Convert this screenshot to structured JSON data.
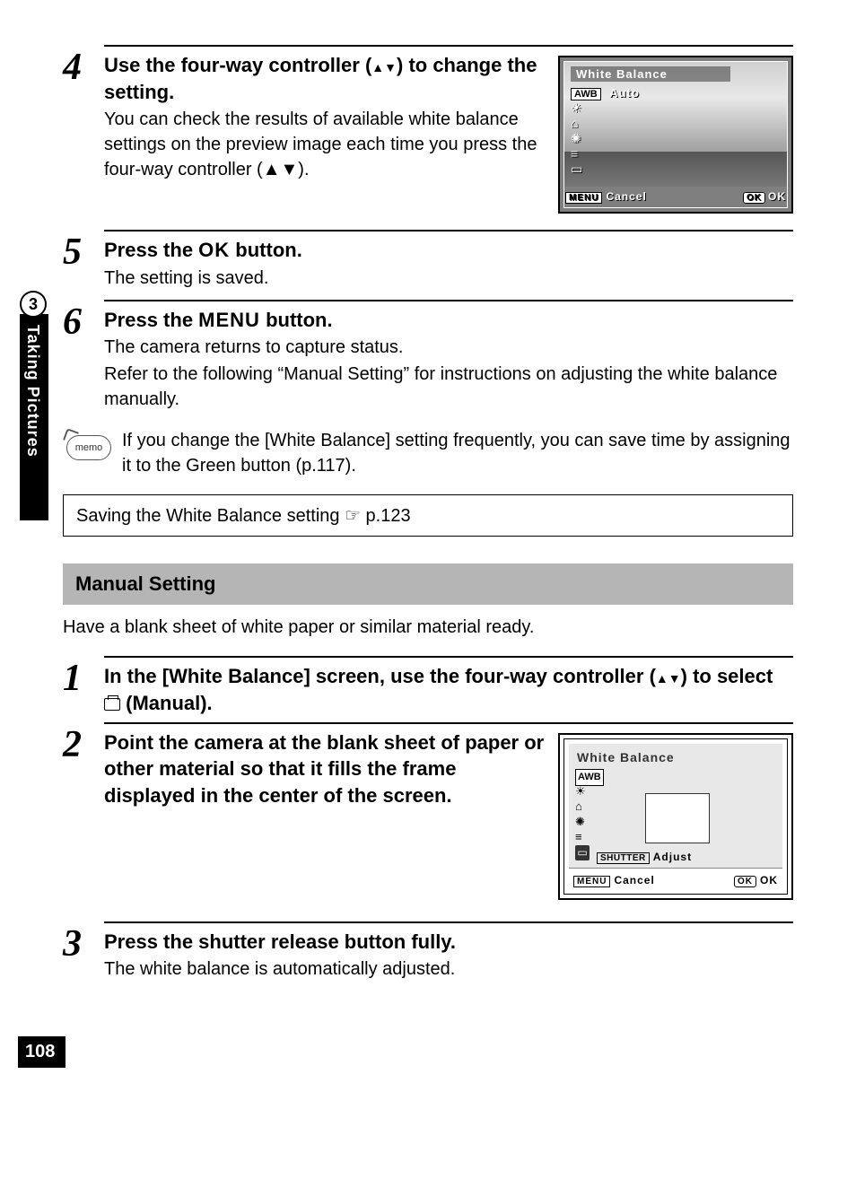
{
  "page_number": "108",
  "side_tab": {
    "number": "3",
    "label": "Taking Pictures"
  },
  "step4": {
    "num": "4",
    "heading_a": "Use the four-way controller (",
    "heading_b": ") to change the setting.",
    "text": "You can check the results of available white balance settings on the preview image each time you press the four-way controller (▲▼)."
  },
  "step5": {
    "num": "5",
    "heading_a": "Press the ",
    "ok": "OK",
    "heading_b": " button.",
    "text": "The setting is saved."
  },
  "step6": {
    "num": "6",
    "heading_a": "Press the ",
    "menu": "MENU",
    "heading_b": " button.",
    "text1": "The camera returns to capture status.",
    "text2": "Refer to the following “Manual Setting” for instructions on adjusting the white balance manually."
  },
  "memo": {
    "label": "memo",
    "text": "If you change the [White Balance] setting frequently, you can save time by assigning it to the Green button (p.117)."
  },
  "refbox": "Saving the White Balance setting ☞ p.123",
  "section_heading": "Manual Setting",
  "section_intro": "Have a blank sheet of white paper or similar material ready.",
  "step1": {
    "num": "1",
    "heading_a": "In the [White Balance] screen, use the four-way controller (",
    "heading_b": ") to select ",
    "heading_c": " (Manual)."
  },
  "step2": {
    "num": "2",
    "heading": "Point the camera at the blank sheet of paper or other material so that it fills the frame displayed in the center of the screen."
  },
  "step3": {
    "num": "3",
    "heading": "Press the shutter release button fully.",
    "text": "The white balance is automatically adjusted."
  },
  "lcd1": {
    "title": "White Balance",
    "awb": "AWB",
    "auto": "Auto",
    "menu": "MENU",
    "cancel": "Cancel",
    "ok_tag": "OK",
    "ok": "OK"
  },
  "lcd2": {
    "title": "White Balance",
    "awb": "AWB",
    "shutter": "SHUTTER",
    "adjust": "Adjust",
    "menu": "MENU",
    "cancel": "Cancel",
    "ok_tag": "OK",
    "ok": "OK"
  },
  "arrows_updown": "▲▼"
}
